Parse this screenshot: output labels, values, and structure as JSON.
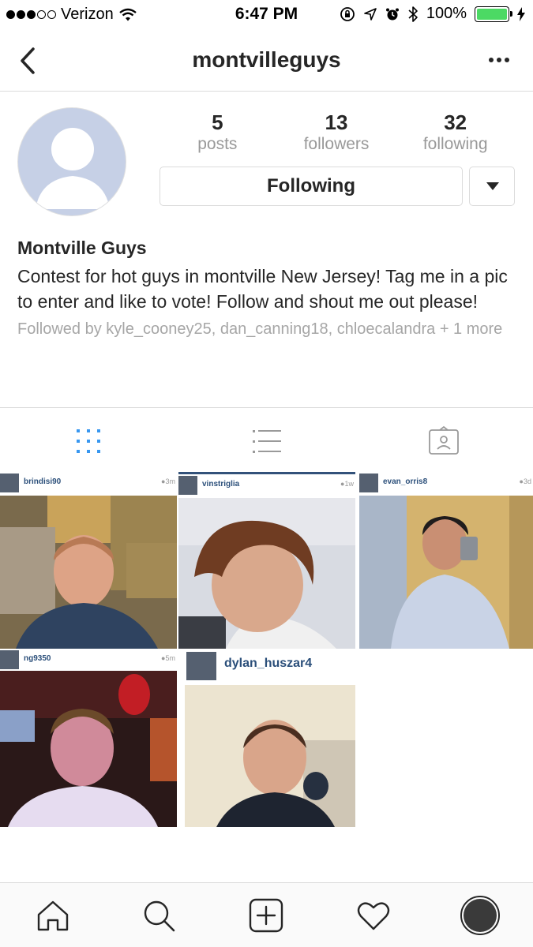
{
  "status_bar": {
    "carrier": "Verizon",
    "time": "6:47 PM",
    "battery": "100%",
    "signal_bars_filled": 3,
    "signal_bars_total": 5
  },
  "nav": {
    "title": "montvilleguys",
    "back_icon": "chevron-left-icon",
    "more_icon": "more-dots-icon"
  },
  "profile": {
    "stats": [
      {
        "value": "5",
        "label": "posts"
      },
      {
        "value": "13",
        "label": "followers"
      },
      {
        "value": "32",
        "label": "following"
      }
    ],
    "follow_button_label": "Following",
    "name": "Montville Guys",
    "bio": "Contest for hot guys in montville New Jersey! Tag me in a pic to enter and like to vote! Follow and shout me out please!",
    "followed_by": "Followed by kyle_cooney25, dan_canning18, chloecalandra + 1 more"
  },
  "tabs": {
    "icons": [
      "grid-icon",
      "list-icon",
      "tagged-icon"
    ],
    "active": "grid-icon",
    "active_color": "#3897f0"
  },
  "posts": [
    {
      "username": "brindisi90",
      "time": "3m"
    },
    {
      "username": "vinstriglia",
      "time": "1w"
    },
    {
      "username": "evan_orris8",
      "time": "3d"
    },
    {
      "username": "ng9350",
      "time": "5m"
    },
    {
      "username": "dylan_huszar4",
      "time": ""
    }
  ],
  "bottom_nav": {
    "icons": [
      "home-icon",
      "search-icon",
      "add-post-icon",
      "activity-heart-icon",
      "profile-avatar-icon"
    ]
  }
}
